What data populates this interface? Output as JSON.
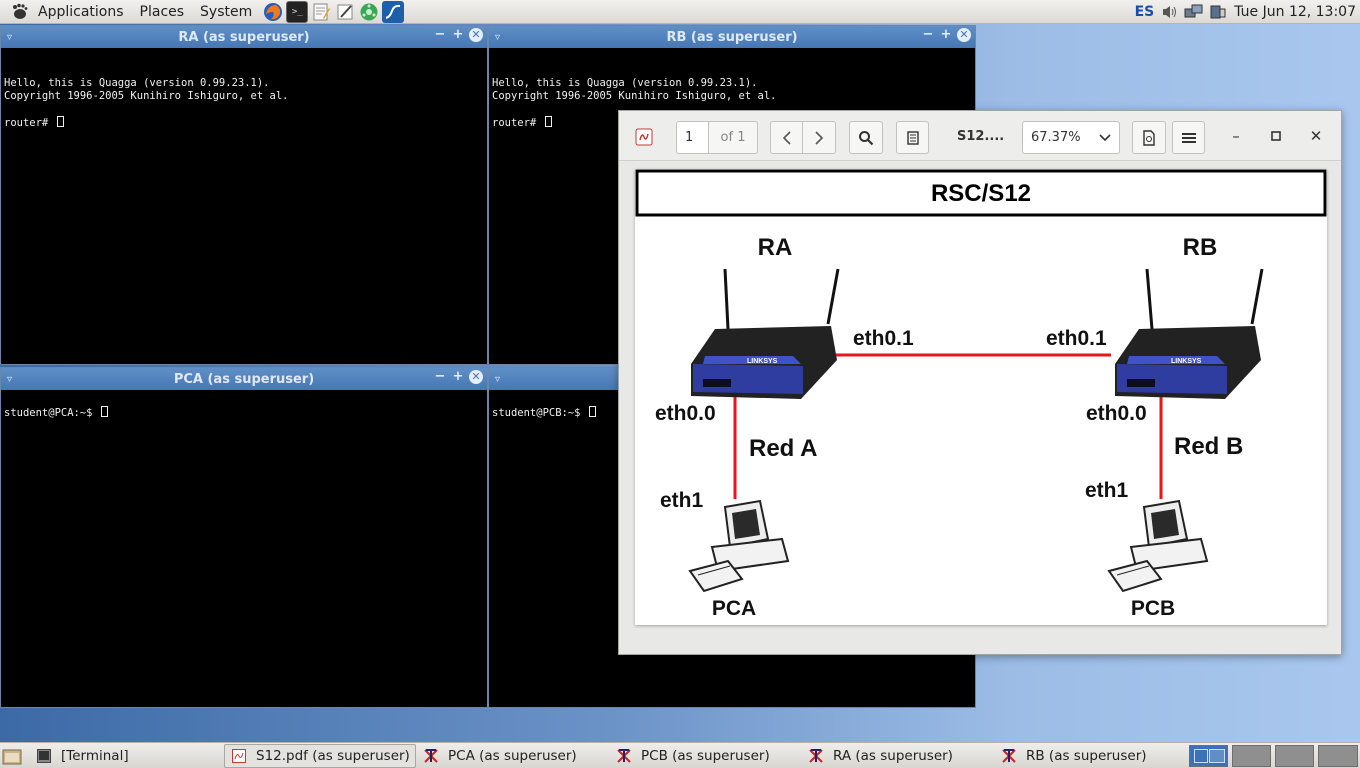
{
  "top_panel": {
    "menus": [
      "Applications",
      "Places",
      "System"
    ],
    "keyboard_layout": "ES",
    "clock": "Tue Jun 12, 13:07"
  },
  "terminals": {
    "ra": {
      "title": "RA (as superuser)",
      "lines": [
        "Hello, this is Quagga (version 0.99.23.1).",
        "Copyright 1996-2005 Kunihiro Ishiguro, et al.",
        "",
        "router# "
      ]
    },
    "rb": {
      "title": "RB (as superuser)",
      "lines": [
        "Hello, this is Quagga (version 0.99.23.1).",
        "Copyright 1996-2005 Kunihiro Ishiguro, et al.",
        "",
        "router# "
      ]
    },
    "pca": {
      "title": "PCA (as superuser)",
      "lines": [
        "student@PCA:~$ "
      ]
    },
    "pcb": {
      "title": "",
      "lines": [
        "student@PCB:~$ "
      ]
    }
  },
  "pdf_viewer": {
    "page_current": "1",
    "page_total": "of 1",
    "doc_title": "S12....",
    "zoom": "67.37%",
    "diagram": {
      "title": "RSC/S12",
      "router_left": "RA",
      "router_right": "RB",
      "link_left_label": "eth0.1",
      "link_right_label": "eth0.1",
      "left_lan_if": "eth0.0",
      "right_lan_if": "eth0.0",
      "net_left": "Red A",
      "net_right": "Red B",
      "pc_left_if": "eth1",
      "pc_right_if": "eth1",
      "pc_left": "PCA",
      "pc_right": "PCB",
      "router_brand": "LINKSYS",
      "link_color": "#e8141c"
    }
  },
  "taskbar": {
    "tasks": [
      {
        "label": "[Terminal]"
      },
      {
        "label": "S12.pdf (as superuser)"
      },
      {
        "label": "PCA (as superuser)"
      },
      {
        "label": "PCB (as superuser)"
      },
      {
        "label": "RA (as superuser)"
      },
      {
        "label": "RB (as superuser)"
      }
    ]
  }
}
